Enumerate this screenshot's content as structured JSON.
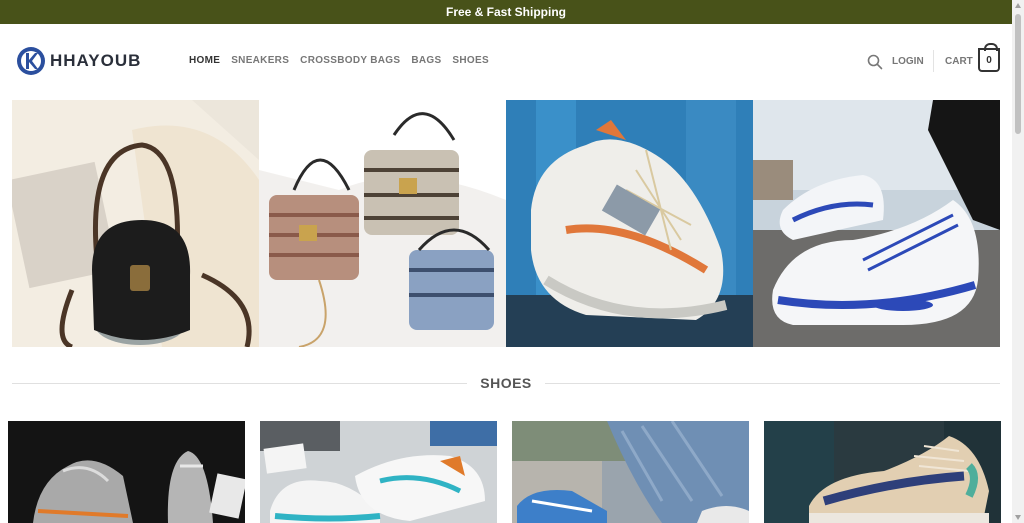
{
  "topbar": {
    "text": "Free & Fast Shipping",
    "bg_color": "#485219"
  },
  "brand": {
    "name": "HHAYOUB",
    "logo_icon": "k-circle-logo"
  },
  "nav": {
    "items": [
      {
        "label": "HOME",
        "active": true
      },
      {
        "label": "SNEAKERS"
      },
      {
        "label": "CROSSBODY BAGS"
      },
      {
        "label": "BAGS"
      },
      {
        "label": "SHOES"
      }
    ]
  },
  "header_actions": {
    "search_icon": "search-icon",
    "login_label": "LOGIN",
    "cart_label": "CART",
    "cart_count": "0"
  },
  "hero": {
    "tiles": [
      {
        "subject": "black-bucket-bag-photo"
      },
      {
        "subject": "woven-mini-bags-photo"
      },
      {
        "subject": "white-orange-sneaker-photo"
      },
      {
        "subject": "white-blue-sneaker-photo"
      }
    ]
  },
  "section": {
    "title": "SHOES"
  },
  "products": [
    {
      "subject": "grey-mesh-sneakers-photo"
    },
    {
      "subject": "white-teal-sneakers-photo"
    },
    {
      "subject": "jeans-blue-sneaker-photo"
    },
    {
      "subject": "navy-beige-sneaker-photo"
    }
  ]
}
